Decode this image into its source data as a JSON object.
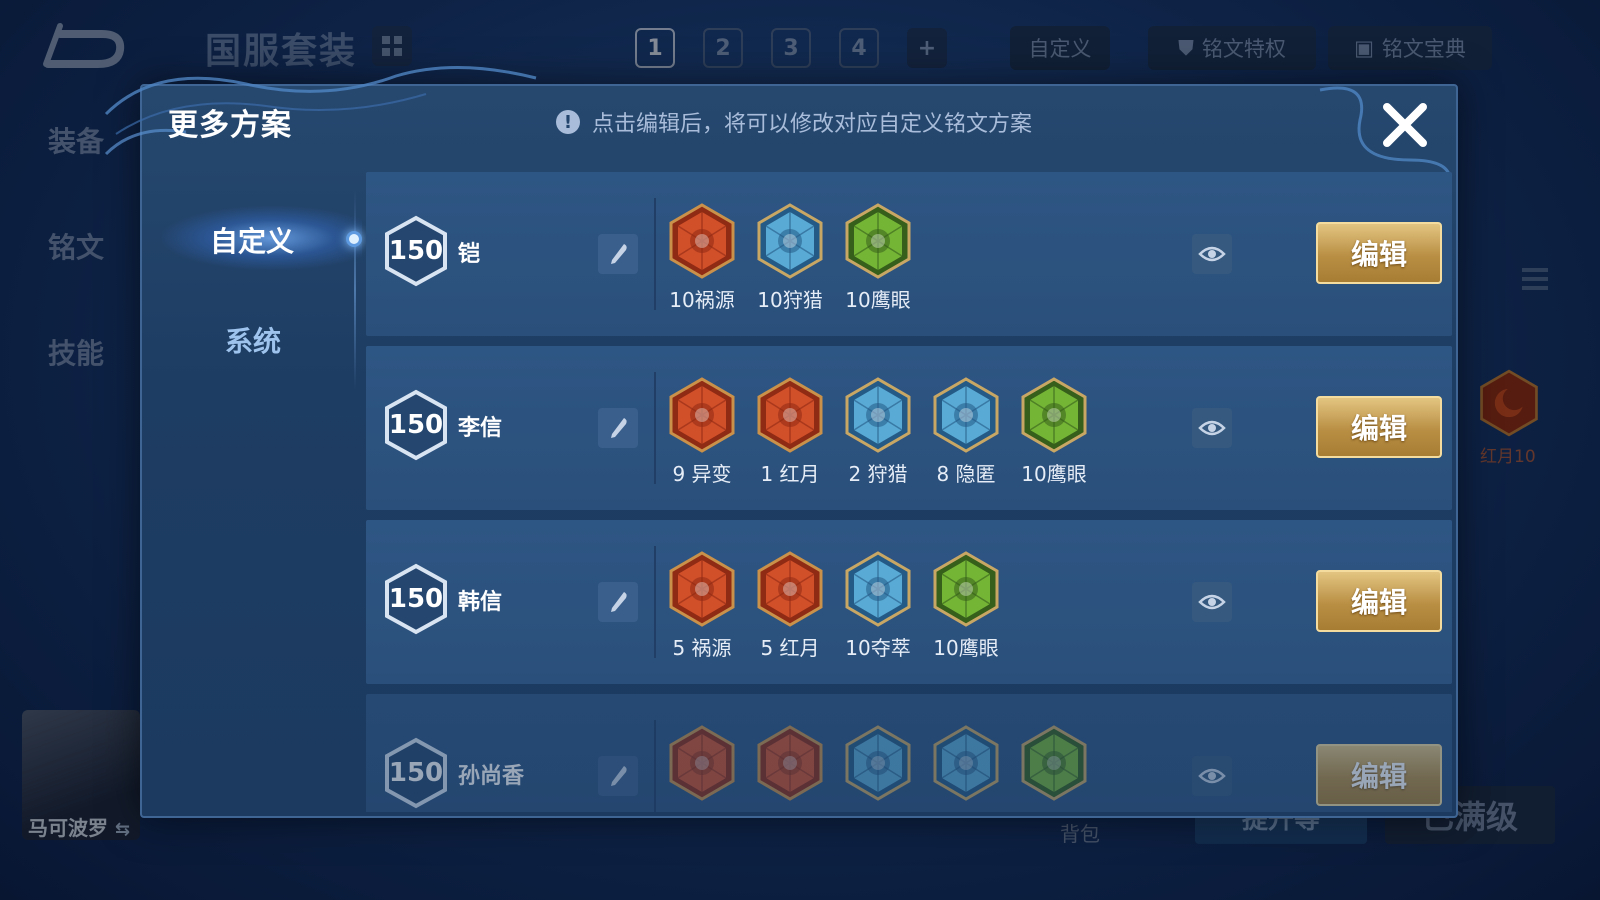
{
  "background": {
    "title": "国服套装",
    "page_tabs": [
      "1",
      "2",
      "3",
      "4",
      "+"
    ],
    "active_page_tab": "1",
    "custom_chip": "自定义",
    "privilege_chip": "铭文特权",
    "codex_chip": "铭文宝典",
    "side_nav": [
      "装备",
      "铭文",
      "技能"
    ],
    "right_rune_label": "红月10",
    "hero_name": "马可波罗",
    "bag_label": "背包",
    "blue_button": "提升等",
    "full_level_button": "已满级"
  },
  "modal": {
    "title": "更多方案",
    "tip": "点击编辑后，将可以修改对应自定义铭文方案",
    "tabs": [
      {
        "label": "自定义",
        "active": true
      },
      {
        "label": "系统",
        "active": false
      }
    ],
    "plans": [
      {
        "level": "150",
        "hero": "铠",
        "edit_label": "编辑",
        "runes": [
          {
            "label": "10祸源",
            "icon": "huoyuan-rune-icon",
            "color": "red"
          },
          {
            "label": "10狩猎",
            "icon": "shoulie-rune-icon",
            "color": "blue"
          },
          {
            "label": "10鹰眼",
            "icon": "yingyan-rune-icon",
            "color": "green"
          }
        ]
      },
      {
        "level": "150",
        "hero": "李信",
        "edit_label": "编辑",
        "runes": [
          {
            "label": "9 异变",
            "icon": "yibian-rune-icon",
            "color": "red"
          },
          {
            "label": "1 红月",
            "icon": "hongyue-rune-icon",
            "color": "red"
          },
          {
            "label": "2 狩猎",
            "icon": "shoulie-rune-icon",
            "color": "blue"
          },
          {
            "label": "8 隐匿",
            "icon": "yinni-rune-icon",
            "color": "blue"
          },
          {
            "label": "10鹰眼",
            "icon": "yingyan-rune-icon",
            "color": "green"
          }
        ]
      },
      {
        "level": "150",
        "hero": "韩信",
        "edit_label": "编辑",
        "runes": [
          {
            "label": "5 祸源",
            "icon": "huoyuan-rune-icon",
            "color": "red"
          },
          {
            "label": "5 红月",
            "icon": "hongyue-rune-icon",
            "color": "red"
          },
          {
            "label": "10夺萃",
            "icon": "duocui-rune-icon",
            "color": "blue"
          },
          {
            "label": "10鹰眼",
            "icon": "yingyan-rune-icon",
            "color": "green"
          }
        ]
      },
      {
        "level": "150",
        "hero": "孙尚香",
        "edit_label": "编辑",
        "runes": [
          {
            "label": "",
            "icon": "red-rune-icon",
            "color": "red"
          },
          {
            "label": "",
            "icon": "red-rune-icon",
            "color": "red"
          },
          {
            "label": "",
            "icon": "shoulie-rune-icon",
            "color": "blue"
          },
          {
            "label": "",
            "icon": "duocui-rune-icon",
            "color": "blue"
          },
          {
            "label": "",
            "icon": "yingyan-rune-icon",
            "color": "green"
          }
        ]
      }
    ]
  },
  "colors": {
    "accent_gold": "#d2ad62",
    "rune_red": "#d8532b",
    "rune_blue": "#5fb3de",
    "rune_green": "#7cbf3a"
  }
}
